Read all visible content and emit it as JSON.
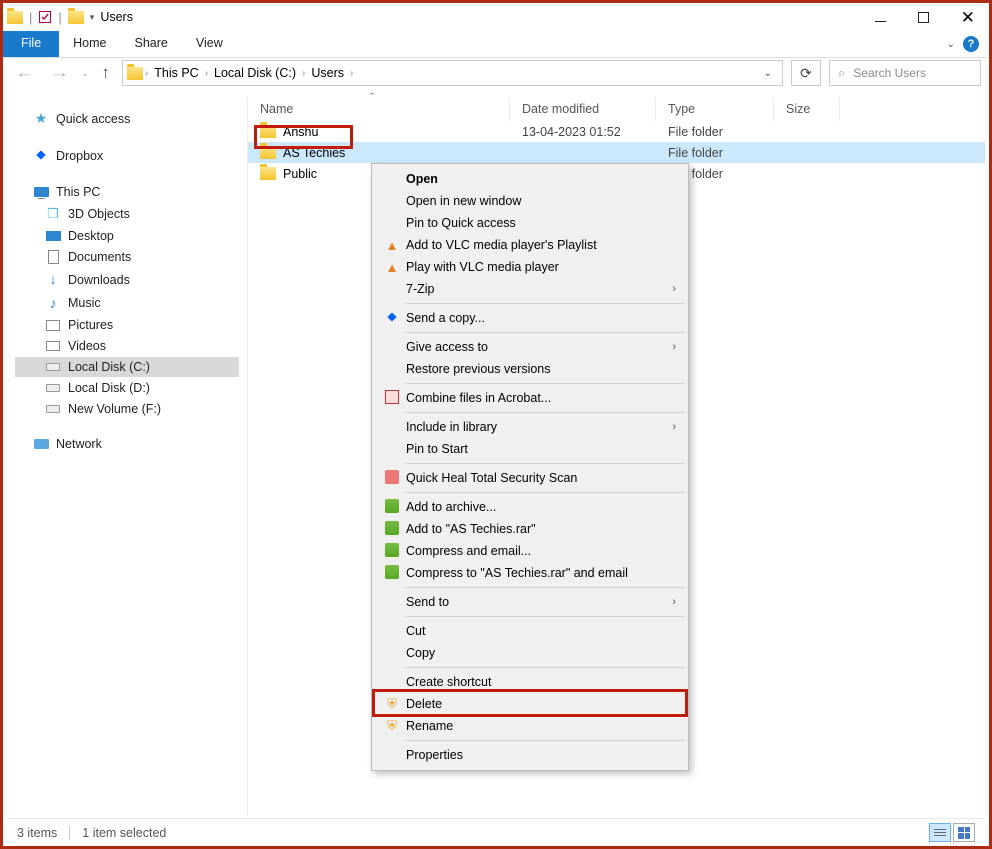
{
  "titlebar": {
    "app_title": "Users"
  },
  "ribbon": {
    "file": "File",
    "tabs": [
      "Home",
      "Share",
      "View"
    ]
  },
  "address": {
    "segments": [
      "This PC",
      "Local Disk (C:)",
      "Users"
    ],
    "search_placeholder": "Search Users"
  },
  "nav_pane": {
    "quick_access": "Quick access",
    "dropbox": "Dropbox",
    "this_pc": "This PC",
    "this_pc_children": [
      "3D Objects",
      "Desktop",
      "Documents",
      "Downloads",
      "Music",
      "Pictures",
      "Videos",
      "Local Disk (C:)",
      "Local Disk (D:)",
      "New Volume (F:)"
    ],
    "network": "Network"
  },
  "columns": {
    "name": "Name",
    "date": "Date modified",
    "type": "Type",
    "size": "Size"
  },
  "files": [
    {
      "name": "Anshu",
      "date": "13-04-2023 01:52",
      "type": "File folder"
    },
    {
      "name": "AS Techies",
      "date": "",
      "type": "File folder"
    },
    {
      "name": "Public",
      "date": "",
      "type": "File folder"
    }
  ],
  "context_menu": {
    "open": "Open",
    "open_new_window": "Open in new window",
    "pin_qa": "Pin to Quick access",
    "vlc_playlist": "Add to VLC media player's Playlist",
    "vlc_play": "Play with VLC media player",
    "sevenzip": "7-Zip",
    "send_copy": "Send a copy...",
    "give_access": "Give access to",
    "restore_prev": "Restore previous versions",
    "combine_acrobat": "Combine files in Acrobat...",
    "include_library": "Include in library",
    "pin_start": "Pin to Start",
    "quickheal": "Quick Heal Total Security Scan",
    "add_archive": "Add to archive...",
    "add_rar": "Add to \"AS Techies.rar\"",
    "compress_email": "Compress and email...",
    "compress_rar_email": "Compress to \"AS Techies.rar\" and email",
    "send_to": "Send to",
    "cut": "Cut",
    "copy": "Copy",
    "create_shortcut": "Create shortcut",
    "delete": "Delete",
    "rename": "Rename",
    "properties": "Properties"
  },
  "statusbar": {
    "count": "3 items",
    "selected": "1 item selected"
  }
}
